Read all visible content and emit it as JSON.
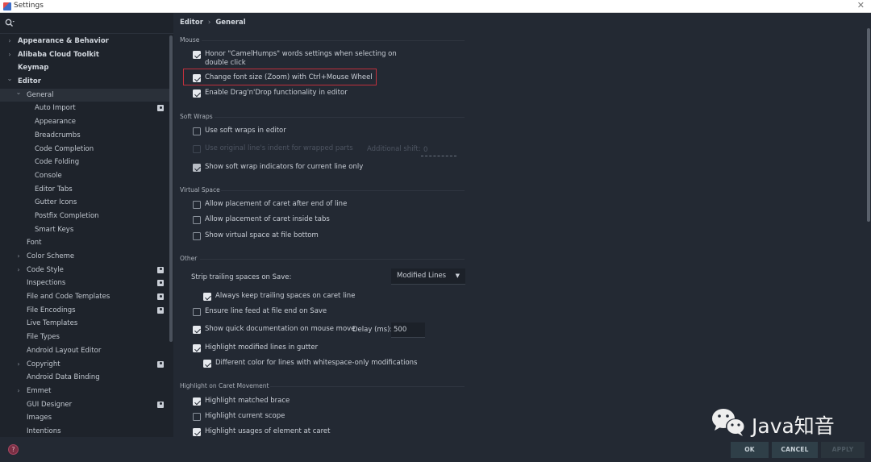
{
  "window": {
    "title": "Settings",
    "close_icon": "close-icon"
  },
  "sidebar": {
    "search_icon": "search-icon",
    "items": [
      {
        "label": "Appearance & Behavior",
        "level": 0,
        "arrow": ">",
        "bold": true,
        "project": false
      },
      {
        "label": "Alibaba Cloud Toolkit",
        "level": 0,
        "arrow": ">",
        "bold": true,
        "project": false
      },
      {
        "label": "Keymap",
        "level": 0,
        "arrow": "",
        "bold": true,
        "project": false
      },
      {
        "label": "Editor",
        "level": 0,
        "arrow": "v",
        "bold": true,
        "project": false
      },
      {
        "label": "General",
        "level": 1,
        "arrow": "v",
        "bold": false,
        "project": false,
        "selected": true
      },
      {
        "label": "Auto Import",
        "level": 2,
        "arrow": "",
        "bold": false,
        "project": true
      },
      {
        "label": "Appearance",
        "level": 2,
        "arrow": "",
        "bold": false,
        "project": false
      },
      {
        "label": "Breadcrumbs",
        "level": 2,
        "arrow": "",
        "bold": false,
        "project": false
      },
      {
        "label": "Code Completion",
        "level": 2,
        "arrow": "",
        "bold": false,
        "project": false
      },
      {
        "label": "Code Folding",
        "level": 2,
        "arrow": "",
        "bold": false,
        "project": false
      },
      {
        "label": "Console",
        "level": 2,
        "arrow": "",
        "bold": false,
        "project": false
      },
      {
        "label": "Editor Tabs",
        "level": 2,
        "arrow": "",
        "bold": false,
        "project": false
      },
      {
        "label": "Gutter Icons",
        "level": 2,
        "arrow": "",
        "bold": false,
        "project": false
      },
      {
        "label": "Postfix Completion",
        "level": 2,
        "arrow": "",
        "bold": false,
        "project": false
      },
      {
        "label": "Smart Keys",
        "level": 2,
        "arrow": "",
        "bold": false,
        "project": false
      },
      {
        "label": "Font",
        "level": 1,
        "arrow": "",
        "bold": false,
        "project": false
      },
      {
        "label": "Color Scheme",
        "level": 1,
        "arrow": ">",
        "bold": false,
        "project": false
      },
      {
        "label": "Code Style",
        "level": 1,
        "arrow": ">",
        "bold": false,
        "project": true
      },
      {
        "label": "Inspections",
        "level": 1,
        "arrow": "",
        "bold": false,
        "project": true
      },
      {
        "label": "File and Code Templates",
        "level": 1,
        "arrow": "",
        "bold": false,
        "project": true
      },
      {
        "label": "File Encodings",
        "level": 1,
        "arrow": "",
        "bold": false,
        "project": true
      },
      {
        "label": "Live Templates",
        "level": 1,
        "arrow": "",
        "bold": false,
        "project": false
      },
      {
        "label": "File Types",
        "level": 1,
        "arrow": "",
        "bold": false,
        "project": false
      },
      {
        "label": "Android Layout Editor",
        "level": 1,
        "arrow": "",
        "bold": false,
        "project": false
      },
      {
        "label": "Copyright",
        "level": 1,
        "arrow": ">",
        "bold": false,
        "project": true
      },
      {
        "label": "Android Data Binding",
        "level": 1,
        "arrow": "",
        "bold": false,
        "project": false
      },
      {
        "label": "Emmet",
        "level": 1,
        "arrow": ">",
        "bold": false,
        "project": false
      },
      {
        "label": "GUI Designer",
        "level": 1,
        "arrow": "",
        "bold": false,
        "project": true
      },
      {
        "label": "Images",
        "level": 1,
        "arrow": "",
        "bold": false,
        "project": false
      },
      {
        "label": "Intentions",
        "level": 1,
        "arrow": "",
        "bold": false,
        "project": false
      }
    ]
  },
  "breadcrumb": {
    "parent": "Editor",
    "separator": "›",
    "current": "General"
  },
  "sections": {
    "mouse": "Mouse",
    "soft_wraps": "Soft Wraps",
    "virtual_space": "Virtual Space",
    "other": "Other",
    "highlight_caret": "Highlight on Caret Movement"
  },
  "options": {
    "camel_humps": {
      "label_line1": "Honor \"CamelHumps\" words settings when selecting on",
      "label_line2": "double click",
      "checked": true
    },
    "zoom_wheel": {
      "label": "Change font size (Zoom) with Ctrl+Mouse Wheel",
      "checked": true
    },
    "drag_drop": {
      "label": "Enable Drag'n'Drop functionality in editor",
      "checked": true
    },
    "soft_wraps": {
      "label": "Use soft wraps in editor",
      "checked": false
    },
    "original_indent": {
      "label": "Use original line's indent for wrapped parts",
      "checked": false,
      "disabled": true
    },
    "wrap_indicators": {
      "label": "Show soft wrap indicators for current line only",
      "checked": true
    },
    "caret_after_eol": {
      "label": "Allow placement of caret after end of line",
      "checked": false
    },
    "caret_inside_tabs": {
      "label": "Allow placement of caret inside tabs",
      "checked": false
    },
    "virtual_space_bottom": {
      "label": "Show virtual space at file bottom",
      "checked": false
    },
    "keep_trailing": {
      "label": "Always keep trailing spaces on caret line",
      "checked": true
    },
    "line_feed": {
      "label": "Ensure line feed at file end on Save",
      "checked": false
    },
    "quick_doc": {
      "label": "Show quick documentation on mouse move",
      "checked": true
    },
    "highlight_modified": {
      "label": "Highlight modified lines in gutter",
      "checked": true
    },
    "whitespace_color": {
      "label": "Different color for lines with whitespace-only modifications",
      "checked": true
    },
    "matched_brace": {
      "label": "Highlight matched brace",
      "checked": true
    },
    "current_scope": {
      "label": "Highlight current scope",
      "checked": false
    },
    "usages": {
      "label": "Highlight usages of element at caret",
      "checked": true
    }
  },
  "fields": {
    "additional_shift_label": "Additional shift:",
    "additional_shift_value": "0",
    "strip_trailing_label": "Strip trailing spaces on Save:",
    "strip_trailing_value": "Modified Lines",
    "delay_label": "Delay (ms):",
    "delay_value": "500"
  },
  "buttons": {
    "ok": "OK",
    "cancel": "CANCEL",
    "apply": "APPLY"
  },
  "watermark": {
    "text": "Java知音"
  },
  "colors": {
    "highlight_border": "#c0303c",
    "background": "#232933",
    "sidebar": "#1e232b"
  }
}
